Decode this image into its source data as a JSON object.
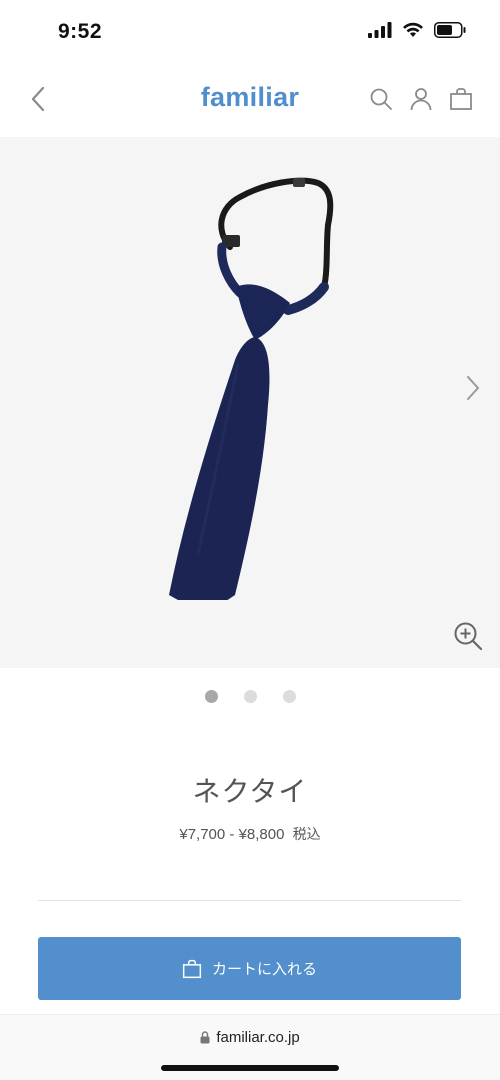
{
  "status_bar": {
    "time": "9:52",
    "icons": [
      "signal-icon",
      "wifi-icon",
      "battery-icon"
    ]
  },
  "header": {
    "logo": "familiar",
    "icons": [
      "back-chevron-icon",
      "search-icon",
      "account-icon",
      "cart-bag-icon"
    ],
    "brand_color": "#4f8fcd"
  },
  "gallery": {
    "image": "navy-necktie",
    "slides": 3,
    "active_slide": 1,
    "background": "#f5f5f5"
  },
  "product": {
    "title": "ネクタイ",
    "price": "¥7,700 - ¥8,800",
    "tax_label": "税込"
  },
  "cart": {
    "button_label": "カートに入れる",
    "button_color": "#528fcc"
  },
  "browser": {
    "url": "familiar.co.jp"
  }
}
